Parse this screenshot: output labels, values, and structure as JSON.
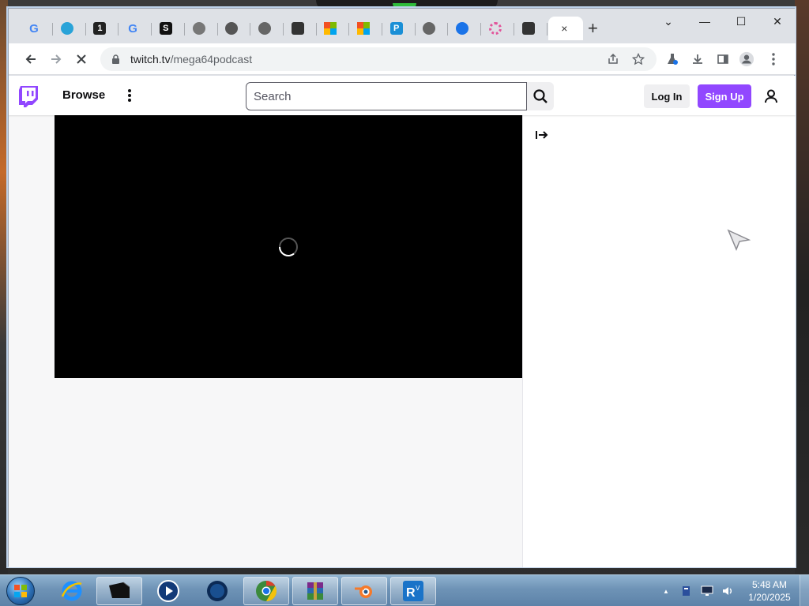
{
  "browser": {
    "tabs": [
      {
        "icon": "google-icon",
        "label": "G",
        "color": "#4285f4"
      },
      {
        "icon": "teal-circle-icon",
        "label": "",
        "color": "#29a3d8"
      },
      {
        "icon": "one-icon",
        "label": "1",
        "color": "#222222"
      },
      {
        "icon": "google-icon",
        "label": "G",
        "color": "#4285f4"
      },
      {
        "icon": "s-icon",
        "label": "S",
        "color": "#111111"
      },
      {
        "icon": "globe-icon",
        "label": "",
        "color": "#777777"
      },
      {
        "icon": "globe-icon",
        "label": "",
        "color": "#555555"
      },
      {
        "icon": "chrome-icon",
        "label": "",
        "color": "#666666"
      },
      {
        "icon": "terminal-icon",
        "label": "",
        "color": "#333333"
      },
      {
        "icon": "microsoft-icon",
        "label": "",
        "color": "#f25022"
      },
      {
        "icon": "microsoft-icon",
        "label": "",
        "color": "#f25022"
      },
      {
        "icon": "p-icon",
        "label": "P",
        "color": "#1a8fd6"
      },
      {
        "icon": "globe-icon",
        "label": "",
        "color": "#666666"
      },
      {
        "icon": "gear-icon",
        "label": "",
        "color": "#1a73e8"
      },
      {
        "icon": "flower-icon",
        "label": "",
        "color": "#e2559b"
      },
      {
        "icon": "terminal-icon",
        "label": "",
        "color": "#333333"
      }
    ],
    "active_tab_close": "×",
    "new_tab": "+",
    "window_controls": {
      "tab_search": "⌄",
      "minimize": "—",
      "maximize": "☐",
      "close": "✕"
    },
    "url_host": "twitch.tv",
    "url_path": "/mega64podcast"
  },
  "twitch": {
    "browse": "Browse",
    "search_placeholder": "Search",
    "login": "Log In",
    "signup": "Sign Up"
  },
  "taskbar": {
    "time": "5:48 AM",
    "date": "1/20/2025",
    "tray_up_arrow": "▲"
  }
}
